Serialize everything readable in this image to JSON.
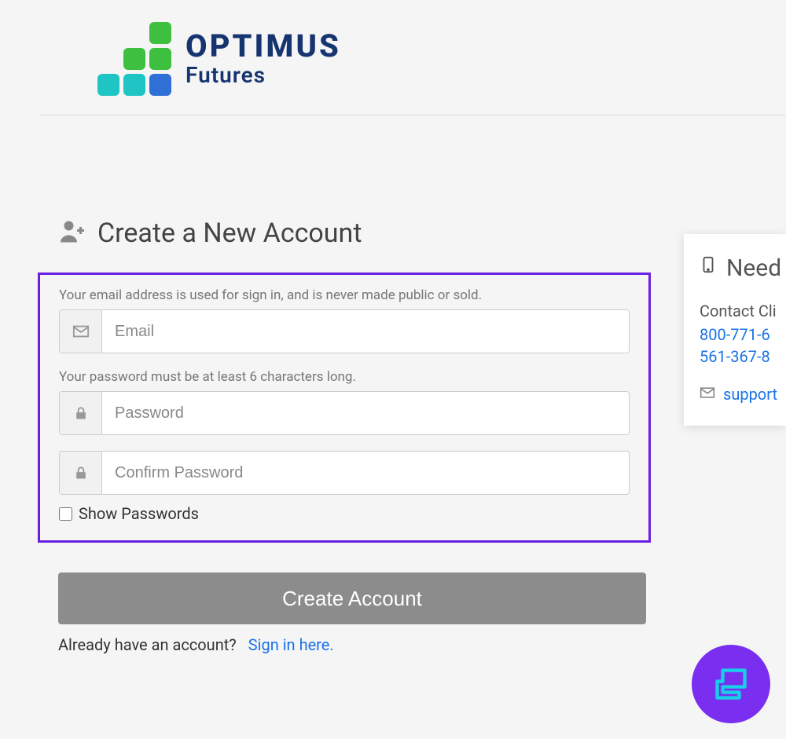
{
  "brand": {
    "name": "OPTIMUS",
    "subtitle": "Futures",
    "colors": {
      "green": "#3fbf3f",
      "teal": "#1fc4c4",
      "blue": "#2f6fd6",
      "navy": "#16346f"
    }
  },
  "page": {
    "title": "Create a New Account"
  },
  "form": {
    "email_helper": "Your email address is used for sign in, and is never made public or sold.",
    "email_placeholder": "Email",
    "password_helper": "Your password must be at least 6 characters long.",
    "password_placeholder": "Password",
    "confirm_placeholder": "Confirm Password",
    "show_passwords_label": "Show Passwords",
    "submit_label": "Create Account"
  },
  "signin": {
    "prompt": "Already have an account?",
    "link": "Sign in here."
  },
  "help": {
    "title": "Need",
    "contact_label": "Contact Cli",
    "phone1": "800-771-6",
    "phone2": "561-367-8",
    "email": "support"
  }
}
